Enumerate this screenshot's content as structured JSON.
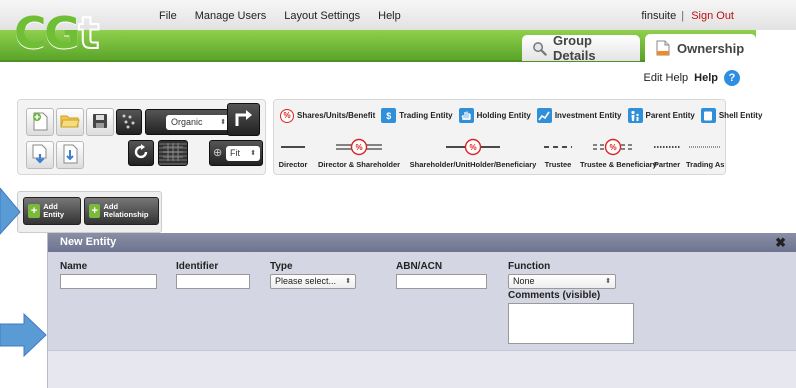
{
  "menu": {
    "items": [
      "File",
      "Manage Users",
      "Layout Settings",
      "Help"
    ]
  },
  "user": {
    "name": "finsuite",
    "separator": "|",
    "signout_label": "Sign Out"
  },
  "logo": {
    "text_main": "CG",
    "text_outline": "t"
  },
  "tabs": [
    {
      "label": "Group Details",
      "icon": "magnifier-icon"
    },
    {
      "label": "Ownership",
      "icon": "document-icon"
    }
  ],
  "help_bar": {
    "edit_help_label": "Edit Help",
    "help_label": "Help",
    "help_icon_glyph": "?"
  },
  "toolbar": {
    "layout_value": "Organic",
    "zoom_value": "Fit"
  },
  "legend": {
    "pct_glyph": "%",
    "entity_types": [
      {
        "label": "Shares/Units/Benefit",
        "icon": "percent-icon",
        "color": "#d22222"
      },
      {
        "label": "Trading Entity",
        "icon": "dollar-icon",
        "glyph": "$",
        "color": "#2f8fd8"
      },
      {
        "label": "Holding Entity",
        "icon": "hand-icon",
        "color": "#2f8fd8"
      },
      {
        "label": "Investment Entity",
        "icon": "chart-icon",
        "color": "#2f8fd8"
      },
      {
        "label": "Parent Entity",
        "icon": "family-icon",
        "color": "#2f8fd8"
      },
      {
        "label": "Shell Entity",
        "icon": "shell-icon",
        "color": "#2f8fd8"
      }
    ],
    "relationships": [
      {
        "label": "Director",
        "style": "solid"
      },
      {
        "label": "Director & Shareholder",
        "style": "double-pct"
      },
      {
        "label": "Shareholder/UnitHolder/Beneficiary",
        "style": "solid-pct"
      },
      {
        "label": "Trustee",
        "style": "dashed"
      },
      {
        "label": "Trustee & Beneficiary",
        "style": "dashed-double-pct"
      },
      {
        "label": "Partner",
        "style": "dotted"
      },
      {
        "label": "Trading As",
        "style": "fine-dotted"
      }
    ]
  },
  "add_panel": {
    "add_entity_label": "Add Entity",
    "add_relationship_label": "Add Relationship"
  },
  "modal": {
    "title": "New Entity",
    "close_glyph": "✖",
    "fields": {
      "name_label": "Name",
      "identifier_label": "Identifier",
      "type_label": "Type",
      "type_value": "Please select...",
      "abn_label": "ABN/ACN",
      "function_label": "Function",
      "function_value": "None",
      "comments_label": "Comments (visible)"
    }
  },
  "colors": {
    "accent_green": "#6fbe35",
    "signout_red": "#b11111",
    "help_blue": "#2e8ee0",
    "arrow_blue": "#5b9bd5"
  }
}
